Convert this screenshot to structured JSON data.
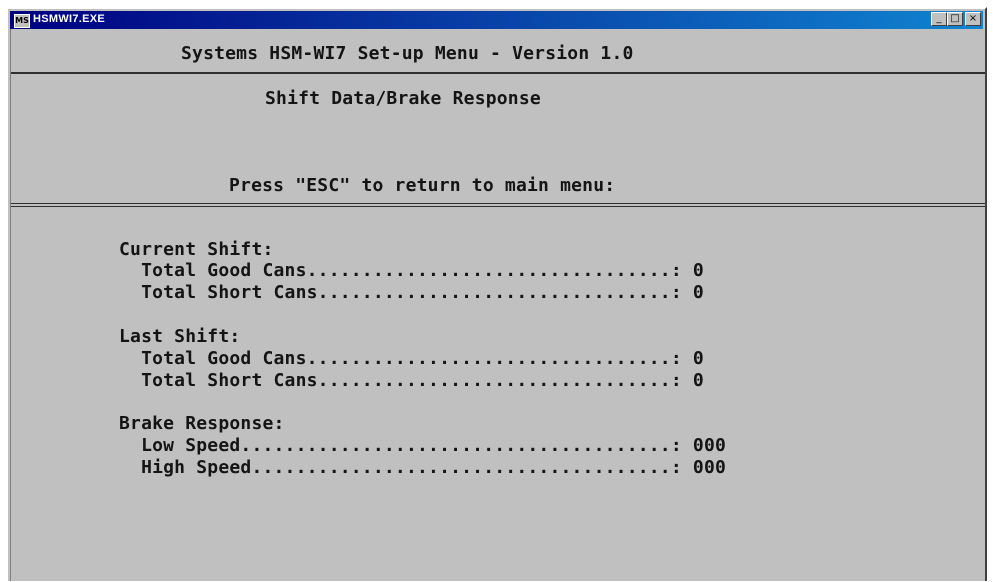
{
  "window": {
    "title": "HSMWI7.EXE",
    "icon": "ms-dos-icon",
    "buttons": {
      "minimize": "_",
      "maximize": "□",
      "close": "×"
    }
  },
  "header": {
    "title": "Systems HSM-WI7 Set-up Menu - Version 1.0",
    "screen_title": "Shift Data/Brake Response",
    "instruction": "Press \"ESC\" to return to main menu:"
  },
  "sections": {
    "current_shift": {
      "heading": "Current Shift:",
      "good_cans": "  Total Good Cans.................................: 0",
      "short_cans": "  Total Short Cans................................: 0"
    },
    "last_shift": {
      "heading": "Last Shift:",
      "good_cans": "  Total Good Cans.................................: 0",
      "short_cans": "  Total Short Cans................................: 0"
    },
    "brake_response": {
      "heading": "Brake Response:",
      "low_speed": "  Low Speed.......................................: 000",
      "high_speed": "  High Speed......................................: 000"
    }
  },
  "colors": {
    "console_bg": "#c0c0c0",
    "text": "#141414",
    "titlebar": "#000080"
  }
}
